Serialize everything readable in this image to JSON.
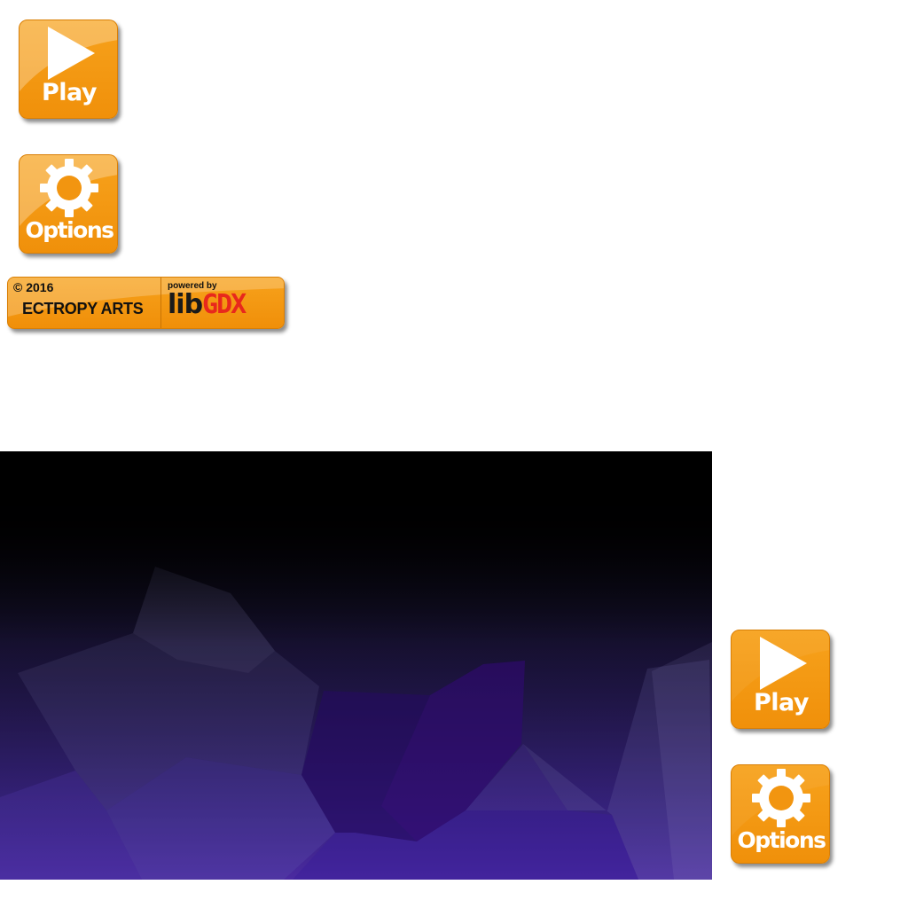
{
  "buttons": {
    "play_label": "Play",
    "options_label": "Options"
  },
  "credits": {
    "copyright": "© 2016",
    "studio": "ECTROPY ARTS",
    "powered_by": "powered by",
    "engine_lib": "lib",
    "engine_gdx": "GDX"
  },
  "colors": {
    "button_orange": "#f39a10",
    "engine_red": "#e8281c",
    "background_top": "#000000",
    "background_bottom": "#4a2a9e"
  },
  "icons": {
    "play": "play-triangle-icon",
    "options": "gear-icon"
  }
}
